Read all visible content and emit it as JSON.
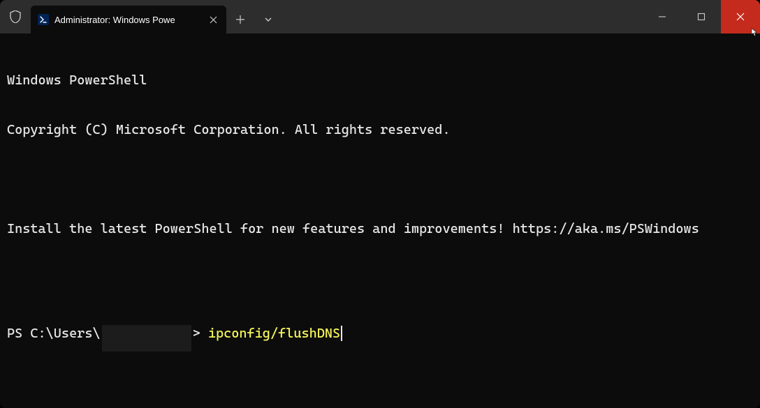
{
  "titlebar": {
    "tab_title": "Administrator: Windows Powe"
  },
  "terminal": {
    "line1": "Windows PowerShell",
    "line2": "Copyright (C) Microsoft Corporation. All rights reserved.",
    "line3": "Install the latest PowerShell for new features and improvements! https://aka.ms/PSWindows",
    "prompt_prefix": "PS C:\\Users\\",
    "prompt_suffix": ">",
    "command": "ipconfig/flushDNS"
  }
}
